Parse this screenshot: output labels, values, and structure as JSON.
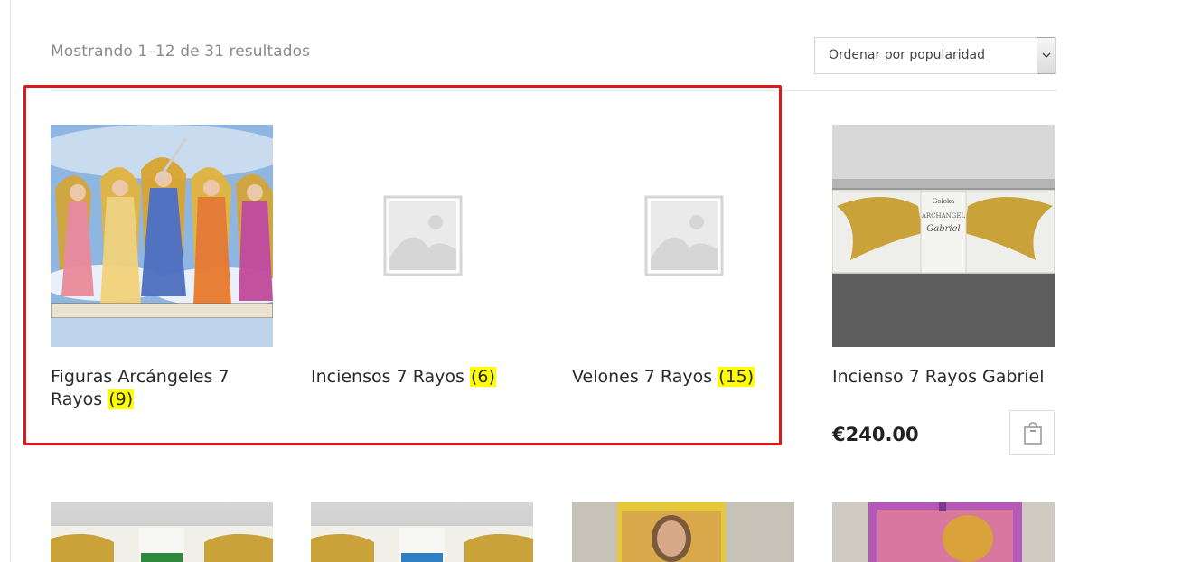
{
  "toolbar": {
    "result_count": "Mostrando 1–12 de 31 resultados",
    "sort_selected": "Ordenar por popularidad"
  },
  "categories": [
    {
      "name": "Figuras Arcángeles 7 Rayos",
      "count": "(9)",
      "image": "archangels-painting"
    },
    {
      "name": "Inciensos 7 Rayos",
      "count": "(6)",
      "image": "placeholder-image-icon"
    },
    {
      "name": "Velones 7 Rayos",
      "count": "(15)",
      "image": "placeholder-image-icon"
    }
  ],
  "product": {
    "title": "Incienso 7 Rayos Gabriel",
    "price": "€240.00",
    "image": "goloka-archangel-gabriel-incense",
    "box_brand": "Goloka",
    "box_line1": "ARCHANGEL",
    "box_line2": "Gabriel"
  },
  "highlight_color": "#e0181b",
  "count_highlight_color": "#ffff00"
}
